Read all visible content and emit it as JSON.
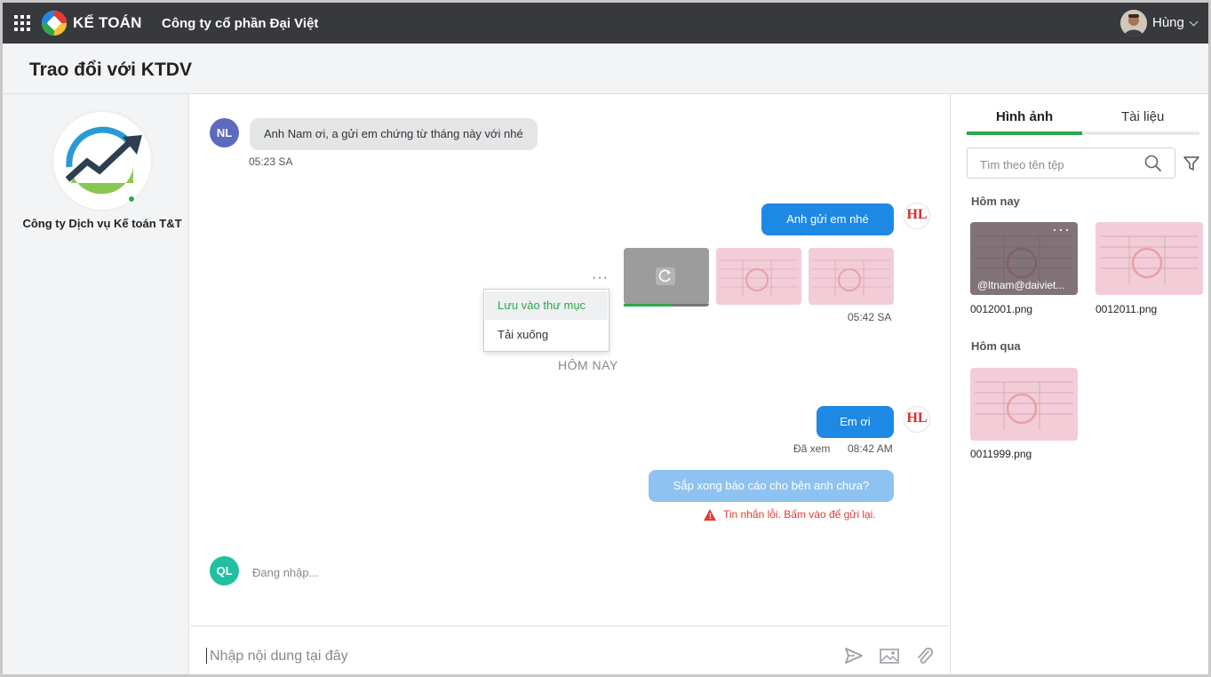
{
  "topbar": {
    "brand": "KẾ TOÁN",
    "company": "Công ty cổ phần Đại Việt",
    "user_name": "Hùng"
  },
  "page": {
    "title": "Trao đổi với KTDV"
  },
  "org": {
    "name": "Công ty Dịch vụ Kế toán T&T"
  },
  "chat": {
    "messages": [
      {
        "avatar": "NL",
        "text": "Anh Nam ơi, a gửi em chứng từ tháng này với nhé",
        "time": "05:23 SA"
      },
      {
        "text": "Anh gửi em nhé",
        "avatar": "HL"
      },
      {
        "time": "05:42 SA"
      },
      {
        "text": "Em ơi",
        "avatar": "HL",
        "seen": "Đã xem",
        "time": "08:42 AM"
      },
      {
        "text": "Sắp xong báo cáo cho bên anh chưa?",
        "error": "Tin nhắn lỗi. Bấm vào để gửi lại."
      }
    ],
    "upload_progress": 0.55,
    "day_separator": "HÔM NAY",
    "menu": {
      "save": "Lưu vào thư mục",
      "download": "Tải xuống"
    },
    "typing": {
      "avatar": "QL",
      "text": "Đang nhập..."
    },
    "more_label": "···"
  },
  "composer": {
    "placeholder": "Nhập nội dung tại đây"
  },
  "files": {
    "tabs": [
      "Hình ảnh",
      "Tài liệu"
    ],
    "search_placeholder": "Tìm theo tên tệp",
    "groups": [
      {
        "label": "Hôm nay",
        "items": [
          {
            "name": "0012001.png",
            "sender": "@ltnam@daiviet..."
          },
          {
            "name": "0012011.png"
          }
        ]
      },
      {
        "label": "Hôm qua",
        "items": [
          {
            "name": "0011999.png"
          }
        ]
      }
    ],
    "more_label": "···"
  },
  "colors": {
    "accent_green": "#2ca84a",
    "bubble_blue": "#1e88e5",
    "error_red": "#e53935",
    "topbar": "#37393d"
  }
}
